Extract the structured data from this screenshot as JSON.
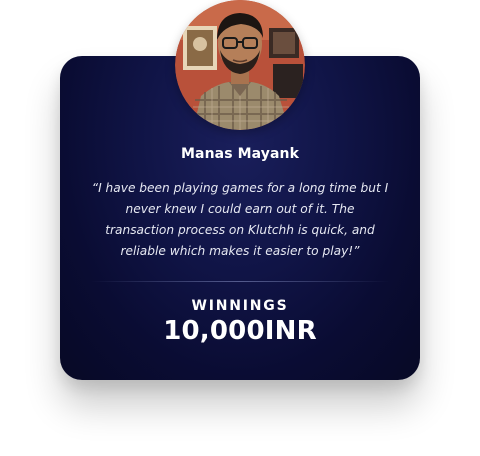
{
  "testimonial": {
    "name": "Manas Mayank",
    "quote_lines": [
      "“I have been playing games for a long time but I",
      "never knew I could earn out of it. The",
      "transaction process on Klutchh is quick, and",
      "reliable which makes it easier to play!”"
    ],
    "winnings_label": "WINNINGS",
    "winnings_value": "10,000INR"
  },
  "avatar": {
    "icon": "user-photo"
  },
  "colors": {
    "card_background": "#0b0d36",
    "text_primary": "#ffffff",
    "text_quote": "#e6e8f2"
  }
}
